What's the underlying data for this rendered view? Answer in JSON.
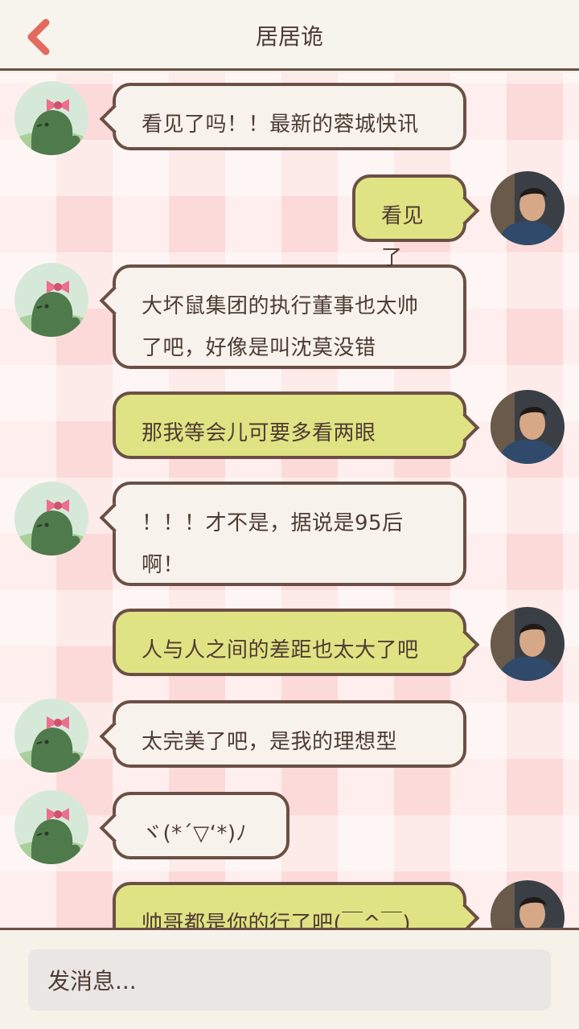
{
  "header": {
    "title": "居居诡",
    "back_icon": "chevron-left-icon",
    "back_color": "#e26a5e"
  },
  "messages": [
    {
      "side": "left",
      "text": "看见了吗！！最新的蓉城快讯"
    },
    {
      "side": "right",
      "text": "看见了"
    },
    {
      "side": "left",
      "text": "大坏鼠集团的执行董事也太帅了吧，好像是叫沈莫没错"
    },
    {
      "side": "right",
      "text": "那我等会儿可要多看两眼"
    },
    {
      "side": "left",
      "text": "！！！才不是，据说是95后啊！"
    },
    {
      "side": "right",
      "text": "人与人之间的差距也太大了吧"
    },
    {
      "side": "left",
      "text": "太完美了吧，是我的理想型"
    },
    {
      "side": "left",
      "text": "ヾ(*´▽‘*)ﾉ"
    },
    {
      "side": "right",
      "text": "帅哥都是你的行了吧(￣^￣)"
    }
  ],
  "input": {
    "placeholder": "发消息..."
  },
  "colors": {
    "left_bubble": "#f7f3ec",
    "right_bubble": "#dfe383",
    "border": "#6b4f45"
  }
}
